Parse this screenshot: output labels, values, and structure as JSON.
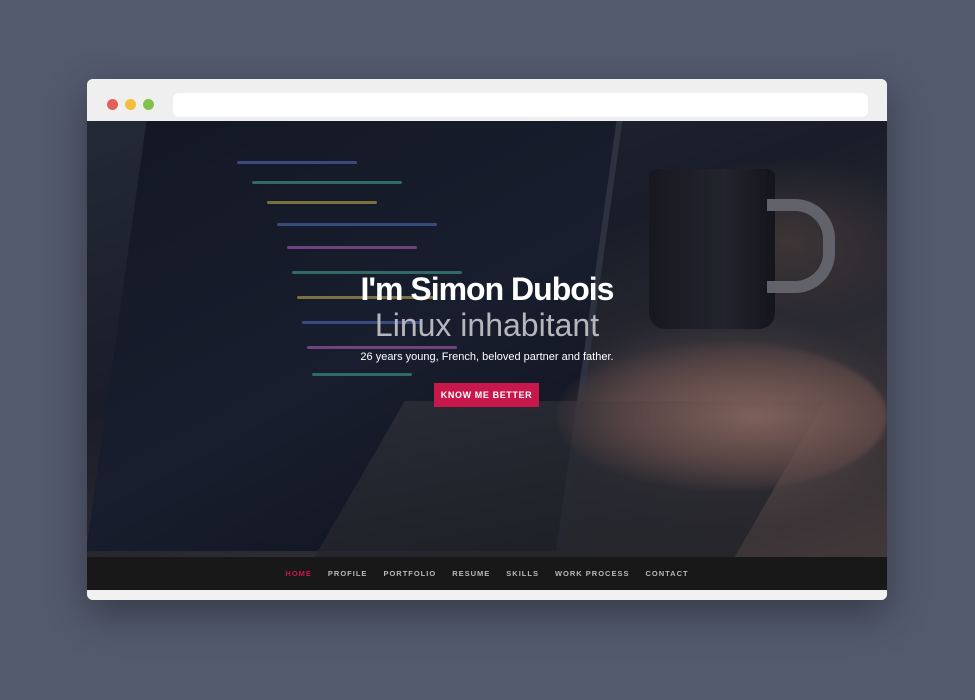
{
  "hero": {
    "title": "I'm Simon Dubois",
    "subtitle": "Linux inhabitant",
    "tagline": "26 years young, French, beloved partner and father.",
    "cta_label": "KNOW ME BETTER"
  },
  "nav": {
    "items": [
      {
        "label": "HOME",
        "active": true
      },
      {
        "label": "PROFILE"
      },
      {
        "label": "PORTFOLIO"
      },
      {
        "label": "RESUME"
      },
      {
        "label": "SKILLS"
      },
      {
        "label": "WORK PROCESS"
      },
      {
        "label": "CONTACT"
      }
    ]
  },
  "colors": {
    "accent": "#c8174a",
    "nav_bg": "#181818",
    "desktop_bg": "#535a6e"
  }
}
